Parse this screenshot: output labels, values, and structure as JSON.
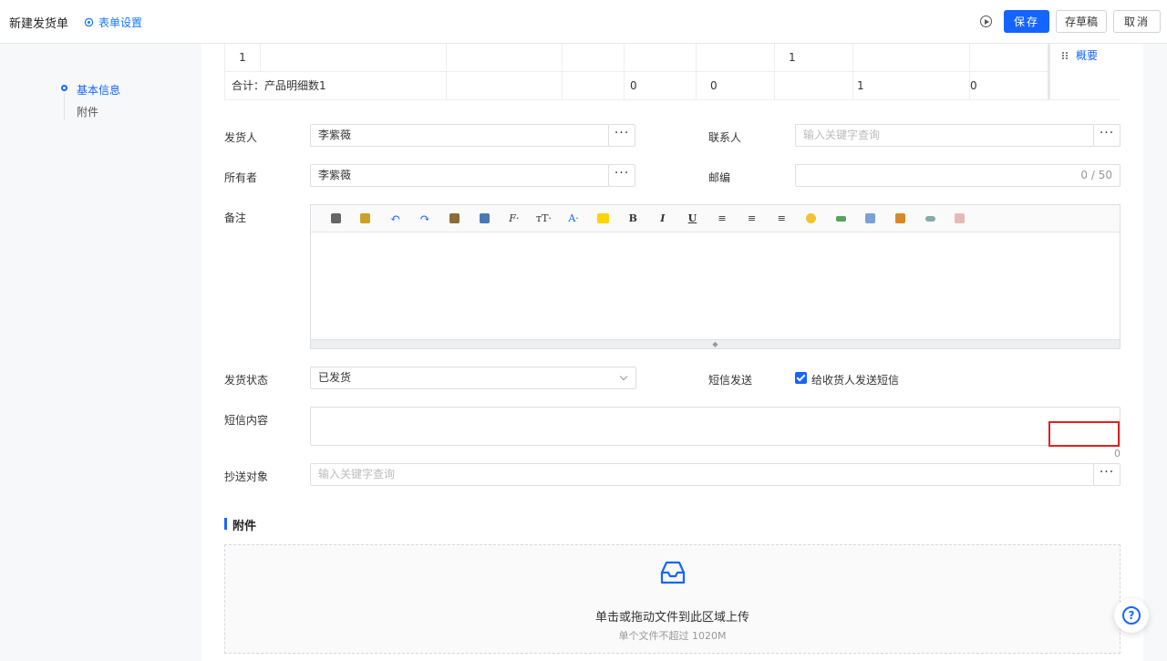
{
  "header": {
    "title": "新建发货单",
    "form_settings": "表单设置",
    "save": "保存",
    "draft": "存草稿",
    "cancel": "取消"
  },
  "anchor_nav": {
    "items": [
      "基本信息",
      "附件"
    ]
  },
  "summary_tab": "概要",
  "product_table": {
    "row": {
      "index": "1",
      "qty": "1"
    },
    "total": {
      "label": "合计：产品明细数1",
      "v1": "0",
      "v2": "0",
      "v3": "1",
      "v4": "0"
    }
  },
  "fields": {
    "shipper": {
      "label": "发货人",
      "value": "李紫薇"
    },
    "contact": {
      "label": "联系人",
      "placeholder": "输入关键字查询"
    },
    "owner": {
      "label": "所有者",
      "value": "李紫薇"
    },
    "zipcode": {
      "label": "邮编",
      "counter": "0 / 50"
    },
    "remark": {
      "label": "备注"
    },
    "ship_status": {
      "label": "发货状态",
      "value": "已发货"
    },
    "sms_send": {
      "label": "短信发送",
      "option": "给收货人发送短信"
    },
    "sms_content": {
      "label": "短信内容",
      "counter": "0"
    },
    "cc": {
      "label": "抄送对象",
      "placeholder": "输入关键字查询"
    }
  },
  "ellipsis": "···",
  "attachment": {
    "title": "附件",
    "upload_main": "单击或拖动文件到此区域上传",
    "upload_sub": "单个文件不超过 1020M"
  },
  "help": "?",
  "colors": {
    "primary": "#1664ff",
    "highlight": "#e02020"
  }
}
